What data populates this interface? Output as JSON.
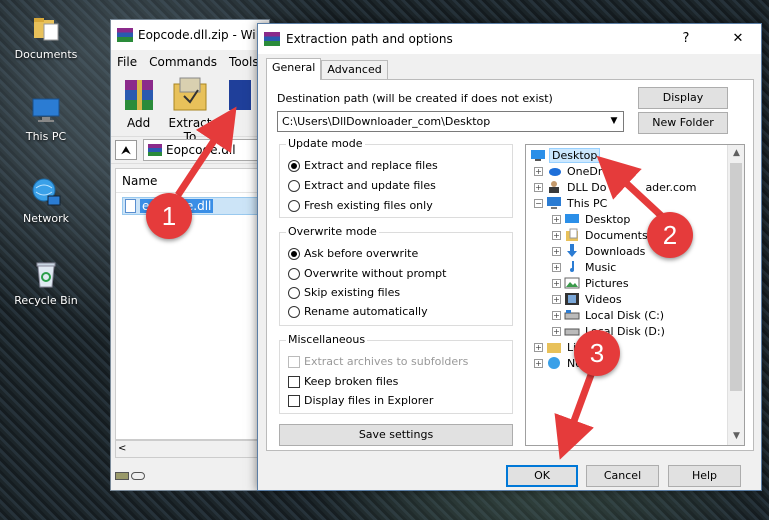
{
  "desktop": {
    "icons": [
      {
        "label": "Documents",
        "icon": "folder-icon"
      },
      {
        "label": "This PC",
        "icon": "computer-icon"
      },
      {
        "label": "Network",
        "icon": "network-icon"
      },
      {
        "label": "Recycle Bin",
        "icon": "recycle-bin-icon"
      }
    ]
  },
  "winrar": {
    "title": "Eopcode.dll.zip - Wi",
    "menu": [
      "File",
      "Commands",
      "Tools"
    ],
    "toolbar": {
      "add": "Add",
      "extract_to": "Extract To"
    },
    "path": "Eopcode.dll",
    "column_name": "Name",
    "file": "eopcode.dll",
    "scroll_left": "<"
  },
  "dialog": {
    "title": "Extraction path and options",
    "help": "?",
    "close": "✕",
    "tabs": {
      "general": "General",
      "advanced": "Advanced"
    },
    "destination_label": "Destination path (will be created if does not exist)",
    "destination_value": "C:\\Users\\DllDownloader_com\\Desktop",
    "display_button": "Display",
    "new_folder_button": "New Folder",
    "update_mode": {
      "title": "Update mode",
      "options": [
        "Extract and replace files",
        "Extract and update files",
        "Fresh existing files only"
      ],
      "selected": 0
    },
    "overwrite_mode": {
      "title": "Overwrite mode",
      "options": [
        "Ask before overwrite",
        "Overwrite without prompt",
        "Skip existing files",
        "Rename automatically"
      ],
      "selected": 0
    },
    "misc": {
      "title": "Miscellaneous",
      "options": [
        "Extract archives to subfolders",
        "Keep broken files",
        "Display files in Explorer"
      ]
    },
    "save_settings": "Save settings",
    "tree": {
      "desktop": "Desktop",
      "onedrive": "OneDr",
      "dlldownloader": "DLL Do",
      "dlldownloader_tail": "ader.com",
      "thispc": "This PC",
      "children": [
        "Desktop",
        "Documents",
        "Downloads",
        "Music",
        "Pictures",
        "Videos",
        "Local Disk (C:)",
        "Local Disk (D:)"
      ],
      "libraries": "Libr",
      "network": "Ne"
    },
    "ok": "OK",
    "cancel": "Cancel",
    "help_button": "Help"
  },
  "annotations": {
    "step1": "1",
    "step2": "2",
    "step3": "3",
    "color": "#e53b3b"
  }
}
